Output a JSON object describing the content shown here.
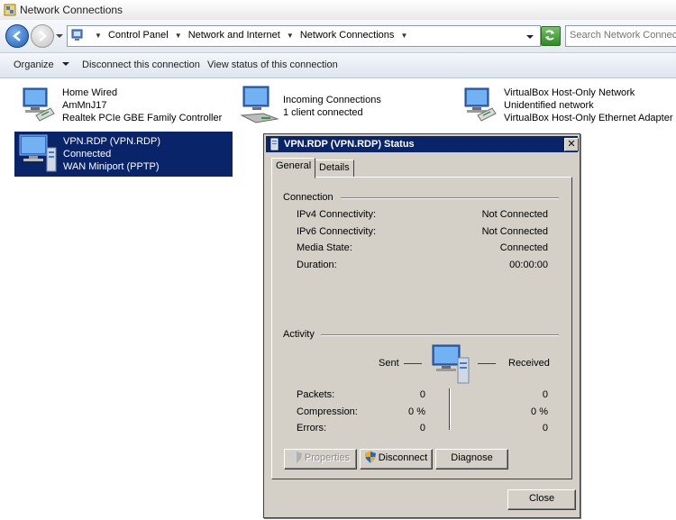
{
  "window": {
    "title": "Network Connections"
  },
  "address": {
    "crumbs": [
      "Control Panel",
      "Network and Internet",
      "Network Connections"
    ],
    "search_placeholder": "Search Network Connections"
  },
  "toolbar": {
    "organize": "Organize",
    "disconnect": "Disconnect this connection",
    "view_status": "View status of this connection"
  },
  "connections": [
    {
      "name": "Home Wired",
      "status": "AmMnJ17",
      "device": "Realtek PCIe GBE Family Controller"
    },
    {
      "name": "Incoming Connections",
      "status": "1 client connected"
    },
    {
      "name": "VirtualBox Host-Only Network",
      "status": "Unidentified network",
      "device": "VirtualBox Host-Only Ethernet Adapter"
    },
    {
      "name": "VPN.RDP (VPN.RDP)",
      "status": "Connected",
      "device": "WAN Miniport (PPTP)"
    }
  ],
  "dialog": {
    "title": "VPN.RDP (VPN.RDP) Status",
    "close_glyph": "✕",
    "tabs": [
      "General",
      "Details"
    ],
    "connection": {
      "heading": "Connection",
      "rows": [
        {
          "label": "IPv4 Connectivity:",
          "value": "Not Connected"
        },
        {
          "label": "IPv6 Connectivity:",
          "value": "Not Connected"
        },
        {
          "label": "Media State:",
          "value": "Connected"
        },
        {
          "label": "Duration:",
          "value": "00:00:00"
        }
      ]
    },
    "activity": {
      "heading": "Activity",
      "sent": "Sent",
      "received": "Received",
      "rows": [
        {
          "label": "Packets:",
          "sent": "0",
          "received": "0"
        },
        {
          "label": "Compression:",
          "sent": "0 %",
          "received": "0 %"
        },
        {
          "label": "Errors:",
          "sent": "0",
          "received": "0"
        }
      ]
    },
    "buttons": {
      "properties": "Properties",
      "disconnect": "Disconnect",
      "diagnose": "Diagnose",
      "close": "Close"
    }
  },
  "colors": {
    "selection": "#0a246a",
    "dialog_face": "#d4d0c8",
    "title_active": "#0a246a"
  }
}
